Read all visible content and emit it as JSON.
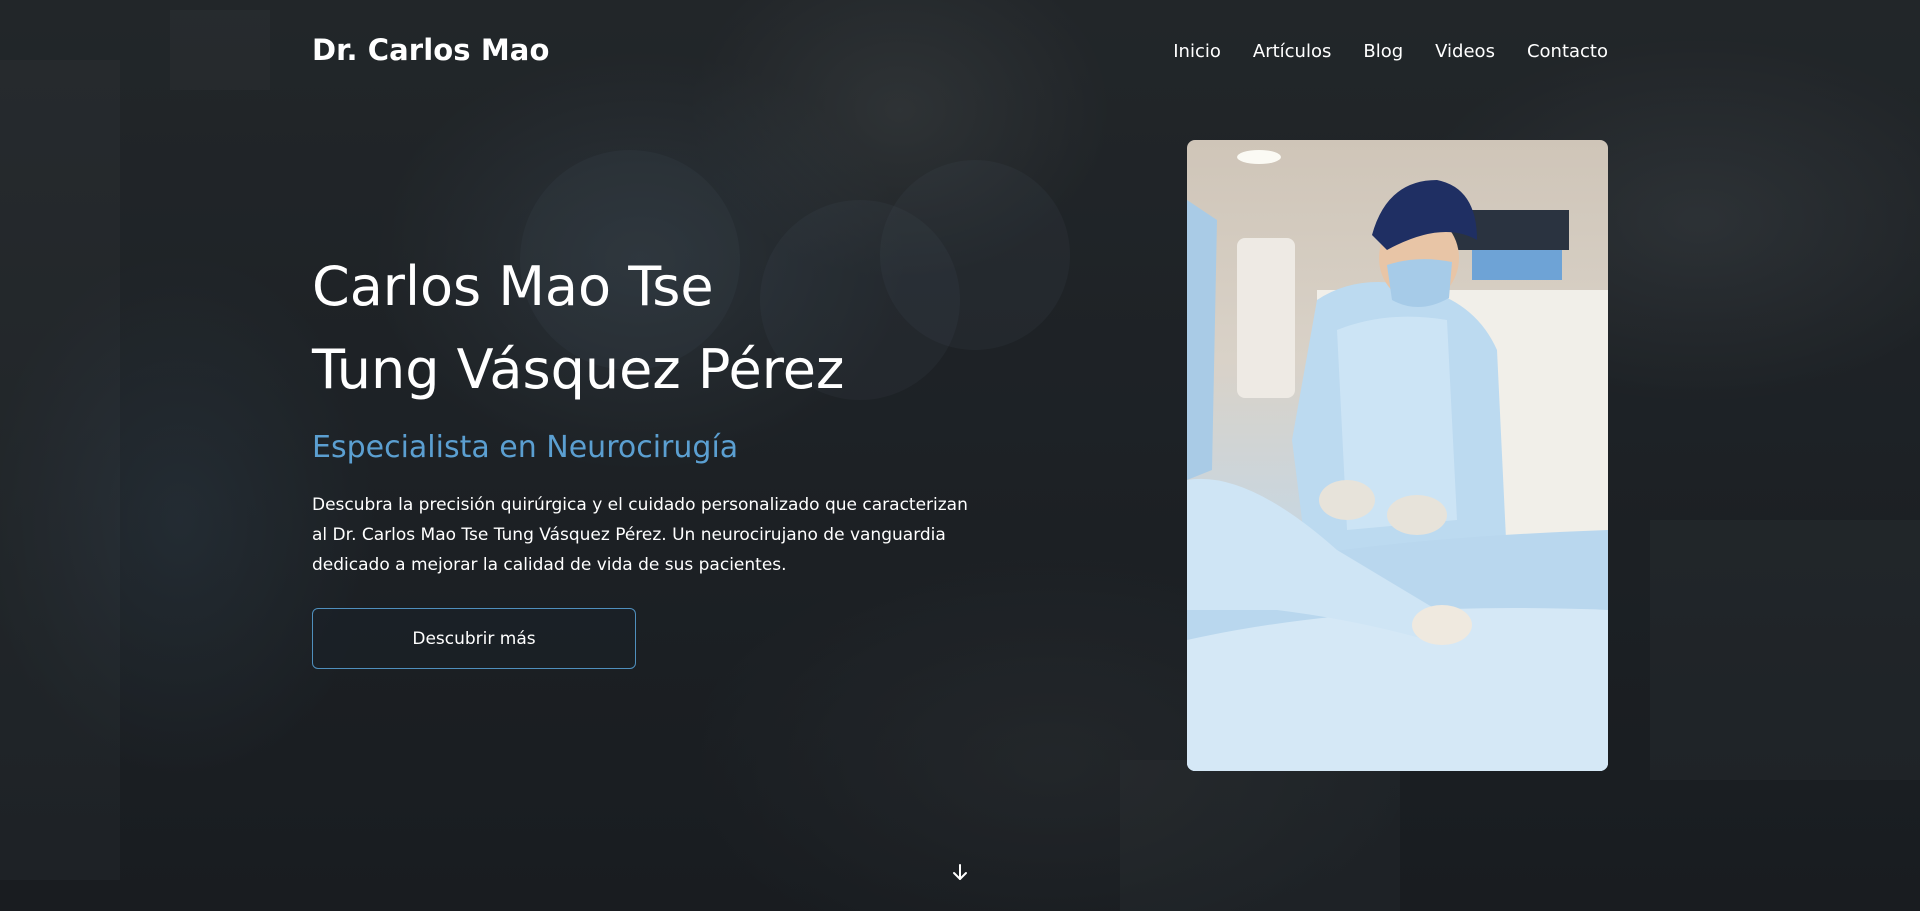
{
  "header": {
    "brand": "Dr. Carlos Mao",
    "nav": [
      "Inicio",
      "Artículos",
      "Blog",
      "Videos",
      "Contacto"
    ]
  },
  "hero": {
    "title_line1": "Carlos Mao Tse",
    "title_line2": "Tung Vásquez Pérez",
    "subtitle": "Especialista en Neurocirugía",
    "description": "Descubra la precisión quirúrgica y el cuidado personalizado que caracterizan al Dr. Carlos Mao Tse Tung Vásquez Pérez. Un neurocirujano de vanguardia dedicado a mejorar la calidad de vida de sus pacientes.",
    "cta_label": "Descubrir más"
  },
  "icons": {
    "scroll": "arrow-down-icon"
  },
  "colors": {
    "accent": "#5b9fd1",
    "button_border": "#4f8fbd",
    "background": "#1f2326"
  }
}
